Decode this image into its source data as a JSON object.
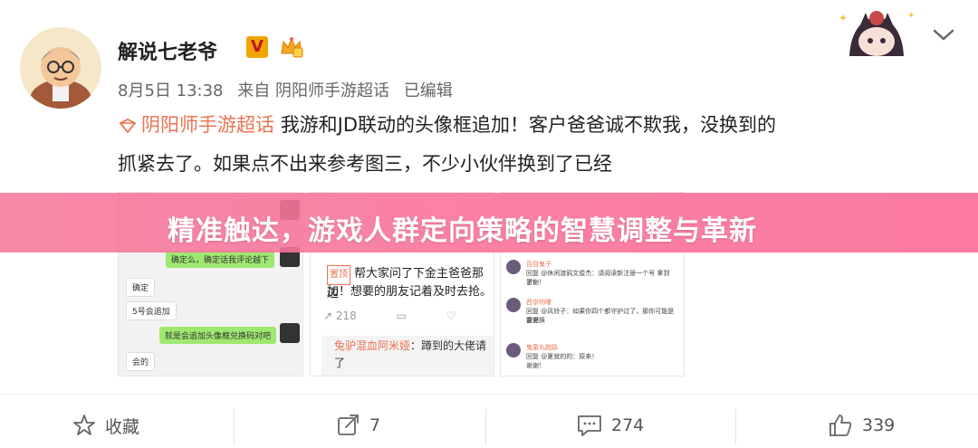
{
  "post": {
    "author": "解说七老爷",
    "verified_badge": "V",
    "date": "8月5日 13:38",
    "source": "来自 阴阳师手游超话",
    "edited": "已编辑",
    "topic": "阴阳师手游超话",
    "text_line1": "我游和JD联动的头像框追加！客户爸爸诚不欺我，没换到的",
    "text_line2": "抓紧去了。如果点不出来参考图三，不少小伙伴换到了已经"
  },
  "banner": {
    "title": "精准触达，游戏人群定向策略的智慧调整与革新"
  },
  "screenshot1": {
    "msgs": [
      "确定么，确定话我评论越下",
      "确定",
      "5号会追加",
      "就是会追加头像框兑换码对吧",
      "会的"
    ]
  },
  "screenshot2": {
    "tag": "置顶",
    "text1": "帮大家问了下金主爸爸那边",
    "text2": "加！想要的朋友记着及时去抢。",
    "count": "218",
    "reply_user": "兔驴混血阿米娅",
    "reply_text1": "：蹲到的大佬请",
    "reply_text2": "了"
  },
  "screenshot3": {
    "rows": [
      {
        "name": "百目鬼子",
        "line1": "回复 @休闲渡鸦文俊杰：请阅读新注册一个号 拿到了！",
        "line2": "谢谢！"
      },
      {
        "name": "西京哟嚯",
        "line1": "回复 @风铃子：如果你四个都守护过了，那你可能是要兑换",
        "line2": "谢谢"
      },
      {
        "name": "鬼童丸跑路",
        "line1": "回复 @夏就的的：原来！",
        "line2": "谢谢！"
      }
    ]
  },
  "actions": {
    "favorite": "收藏",
    "repost": "7",
    "comment": "274",
    "like": "339"
  },
  "colors": {
    "accent": "#eb7350",
    "banner": "#f7789b",
    "vip_gold": "#f0a500"
  }
}
